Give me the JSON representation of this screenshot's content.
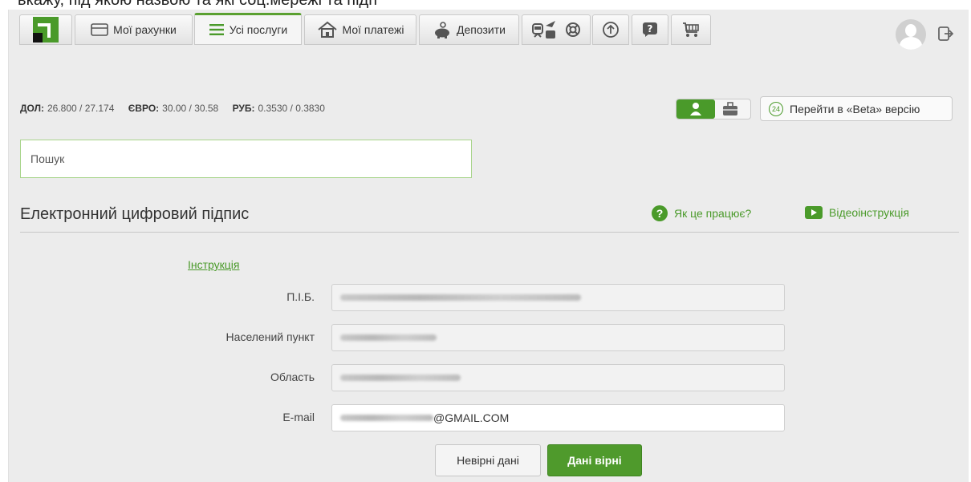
{
  "top_strip_text": "вкажу, під якою назвою та які соц.мережі та підп",
  "tabs": [
    {
      "label": ""
    },
    {
      "label": "Мої рахунки"
    },
    {
      "label": "Усі послуги"
    },
    {
      "label": "Мої платежі"
    },
    {
      "label": "Депозити"
    }
  ],
  "rates": {
    "usd_label": "ДОЛ:",
    "usd_value": "26.800 / 27.174",
    "eur_label": "ЄВРО:",
    "eur_value": "30.00 / 30.58",
    "rub_label": "РУБ:",
    "rub_value": "0.3530 / 0.3830"
  },
  "beta": {
    "badge": "24",
    "label": "Перейти в «Beta» версію"
  },
  "search": {
    "placeholder": "Пошук"
  },
  "section": {
    "title": "Електронний цифровий підпис",
    "how_it_works": "Як це працює?",
    "video": "Відеоінструкція"
  },
  "form": {
    "instruction_link": "Інструкція",
    "fields": [
      {
        "label": "П.І.Б.",
        "value": ""
      },
      {
        "label": "Населений пункт",
        "value": ""
      },
      {
        "label": "Область",
        "value": ""
      },
      {
        "label": "E-mail",
        "value": "@GMAIL.COM"
      }
    ],
    "wrong_button": "Невірні дані",
    "correct_button": "Дані вірні"
  },
  "colors": {
    "accent": "#4a9a2a",
    "background": "#ececec"
  }
}
